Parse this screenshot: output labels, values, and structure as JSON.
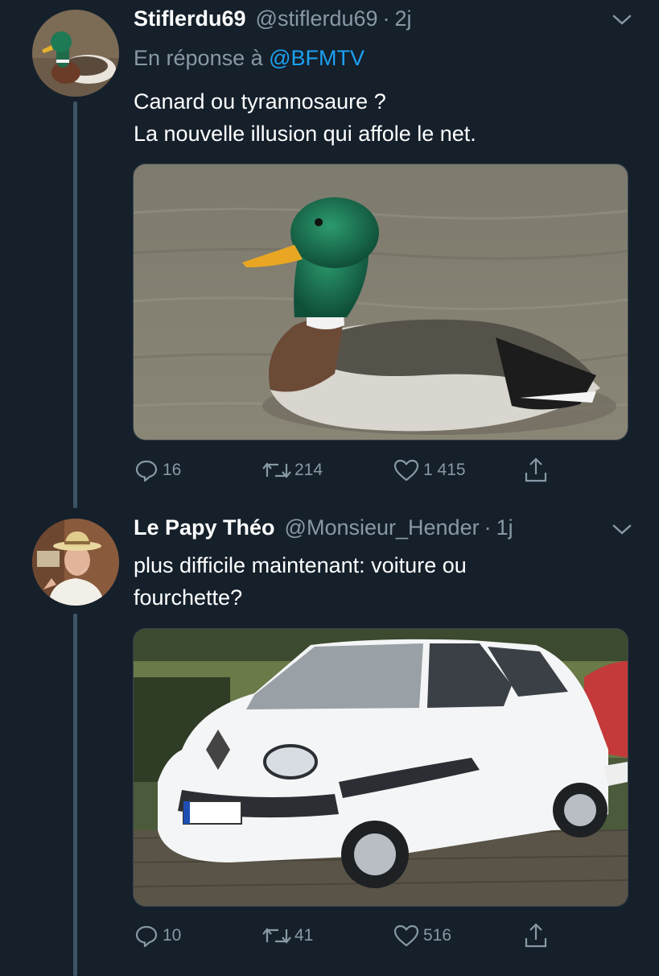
{
  "tweets": [
    {
      "author_name": "Stiflerdu69",
      "handle": "@stiflerdu69",
      "separator": "·",
      "time": "2j",
      "reply_prefix": "En réponse à",
      "reply_mention": "@BFMTV",
      "text_lines": [
        "Canard ou tyrannosaure ?",
        "La nouvelle illusion qui affole le net."
      ],
      "avatar_icon": "duck-avatar",
      "media_icon": "mallard-duck-photo",
      "replies": "16",
      "retweets": "214",
      "likes": "1 415"
    },
    {
      "author_name": "Le Papy Théo",
      "handle": "@Monsieur_Hender",
      "separator": "·",
      "time": "1j",
      "text_lines": [
        "plus difficile maintenant: voiture ou",
        "fourchette?"
      ],
      "avatar_icon": "old-man-hat-avatar",
      "media_icon": "white-car-photo",
      "replies": "10",
      "retweets": "41",
      "likes": "516"
    }
  ],
  "colors": {
    "background": "#15202b",
    "text_primary": "#ffffff",
    "text_secondary": "#8899a6",
    "link": "#1da1f2",
    "thread_line": "#3d5466"
  }
}
